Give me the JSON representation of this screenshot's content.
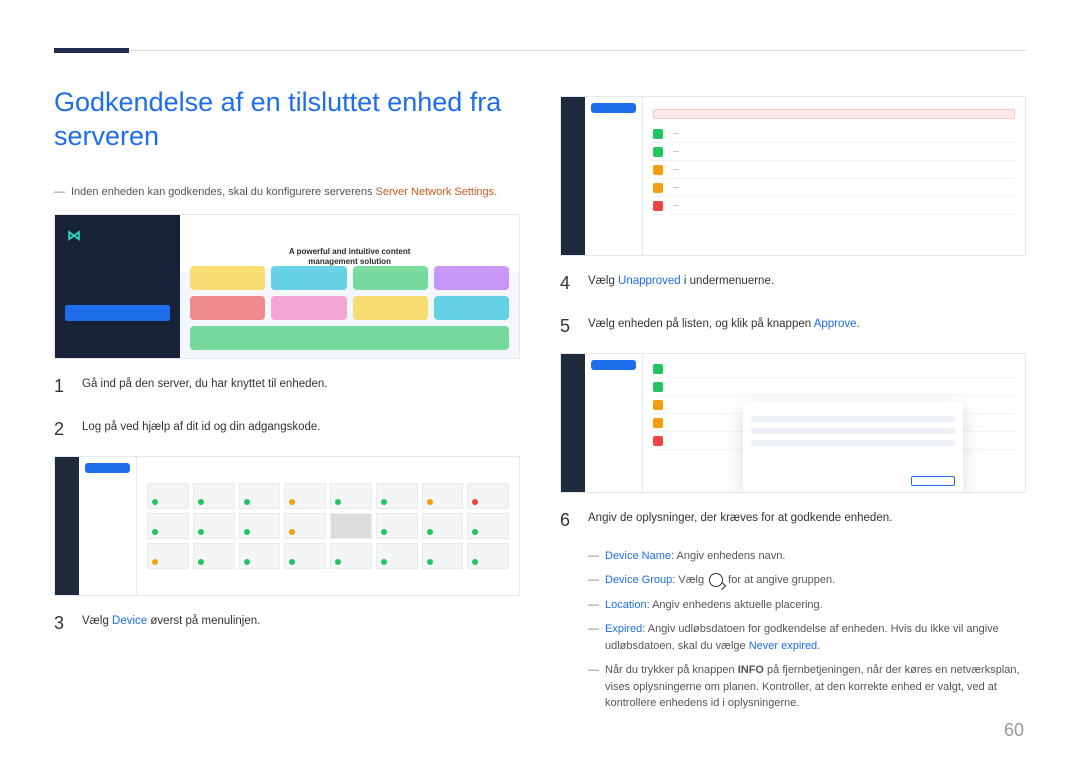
{
  "title": "Godkendelse af en tilsluttet enhed fra serveren",
  "intro_prefix": "Inden enheden kan godkendes, skal du konfigurere serverens ",
  "intro_highlight": "Server Network Settings",
  "intro_suffix": ".",
  "shot1_caption1": "A powerful and intuitive content",
  "shot1_caption2": "management solution",
  "steps": {
    "s1": "Gå ind på den server, du har knyttet til enheden.",
    "s2": "Log på ved hjælp af dit id og din adgangskode.",
    "s3_pre": "Vælg ",
    "s3_link": "Device",
    "s3_post": " øverst på menulinjen.",
    "s4_pre": "Vælg ",
    "s4_link": "Unapproved",
    "s4_post": " i undermenuerne.",
    "s5_pre": "Vælg enheden på listen, og klik på knappen ",
    "s5_link": "Approve",
    "s5_post": ".",
    "s6": "Angiv de oplysninger, der kræves for at godkende enheden."
  },
  "bullets": {
    "b1_label": "Device Name",
    "b1_text": ": Angiv enhedens navn.",
    "b2_label": "Device Group",
    "b2_pre": ": Vælg ",
    "b2_post": " for at angive gruppen.",
    "b3_label": "Location",
    "b3_text": ": Angiv enhedens aktuelle placering.",
    "b4_label": "Expired",
    "b4_text_a": ": Angiv udløbsdatoen for godkendelse af enheden. Hvis du ikke vil angive udløbsdatoen, skal du vælge ",
    "b4_link": "Never expired",
    "b4_text_b": ".",
    "b5_pre": "Når du trykker på knappen ",
    "b5_bold": "INFO",
    "b5_post": " på fjernbetjeningen, når der køres en netværksplan, vises oplysningerne om planen. Kontroller, at den korrekte enhed er valgt, ved at kontrollere enhedens id i oplysningerne."
  },
  "nums": {
    "n1": "1",
    "n2": "2",
    "n3": "3",
    "n4": "4",
    "n5": "5",
    "n6": "6"
  },
  "page_number": "60"
}
